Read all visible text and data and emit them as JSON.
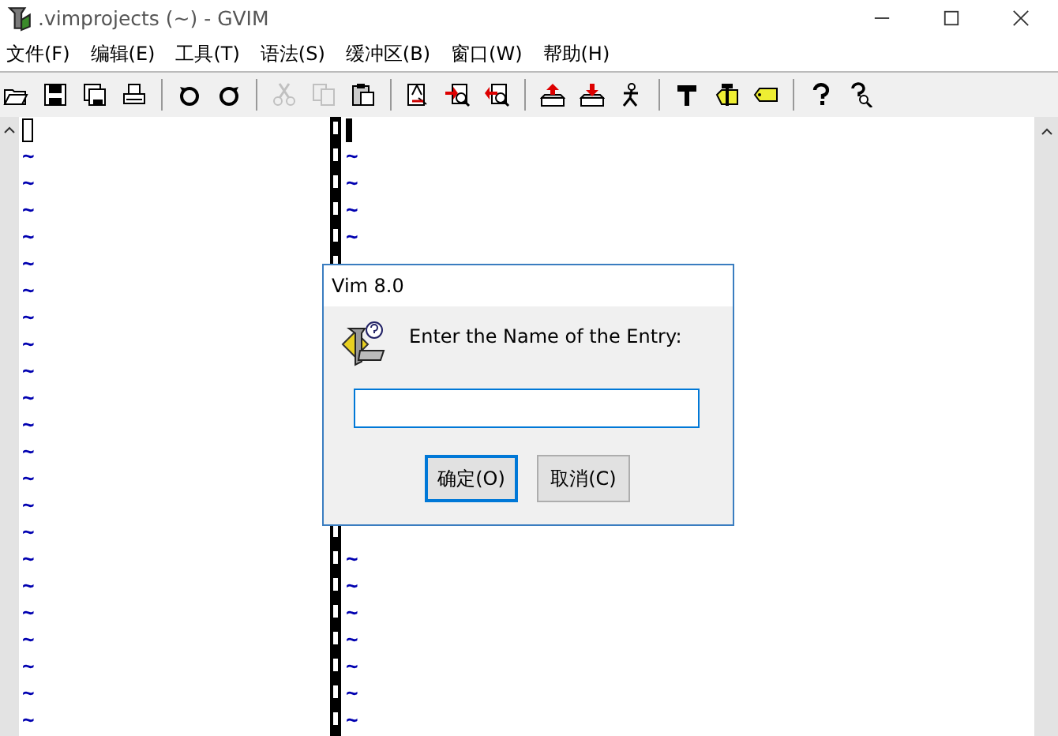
{
  "window": {
    "title": ".vimprojects (~) - GVIM"
  },
  "menu": [
    "文件(F)",
    "编辑(E)",
    "工具(T)",
    "语法(S)",
    "缓冲区(B)",
    "窗口(W)",
    "帮助(H)"
  ],
  "toolbar": [
    {
      "kind": "open",
      "disabled": false
    },
    {
      "kind": "save",
      "disabled": false
    },
    {
      "kind": "saveall",
      "disabled": false
    },
    {
      "kind": "print",
      "disabled": false
    },
    {
      "kind": "sep"
    },
    {
      "kind": "undo",
      "disabled": false
    },
    {
      "kind": "redo",
      "disabled": false
    },
    {
      "kind": "sep"
    },
    {
      "kind": "cut",
      "disabled": true
    },
    {
      "kind": "copy",
      "disabled": true
    },
    {
      "kind": "paste",
      "disabled": false
    },
    {
      "kind": "sep"
    },
    {
      "kind": "replace",
      "disabled": false
    },
    {
      "kind": "findnext",
      "disabled": false
    },
    {
      "kind": "findprev",
      "disabled": false
    },
    {
      "kind": "sep"
    },
    {
      "kind": "loadsession",
      "disabled": false
    },
    {
      "kind": "savesession",
      "disabled": false
    },
    {
      "kind": "runscript",
      "disabled": false
    },
    {
      "kind": "sep"
    },
    {
      "kind": "make",
      "disabled": false
    },
    {
      "kind": "maketags",
      "disabled": false
    },
    {
      "kind": "jumptag",
      "disabled": false
    },
    {
      "kind": "sep"
    },
    {
      "kind": "help",
      "disabled": false
    },
    {
      "kind": "findhelp",
      "disabled": false
    }
  ],
  "left_pane": {
    "lines": [
      "~",
      "~",
      "~",
      "~",
      "~",
      "~",
      "~",
      "~",
      "~",
      "~",
      "~",
      "~",
      "~",
      "~",
      "~",
      "~",
      "~",
      "~",
      "~",
      "~",
      "~",
      "~"
    ]
  },
  "right_pane": {
    "top_lines": [
      "~",
      "~",
      "~",
      "~"
    ],
    "bottom_lines": [
      "~",
      "~",
      "~",
      "~",
      "~",
      "~",
      "~"
    ]
  },
  "dialog": {
    "title": "Vim 8.0",
    "prompt": "Enter the Name of the Entry:",
    "buttons": [
      {
        "label": "确定(O)",
        "default": true
      },
      {
        "label": "取消(C)",
        "default": false
      }
    ]
  }
}
